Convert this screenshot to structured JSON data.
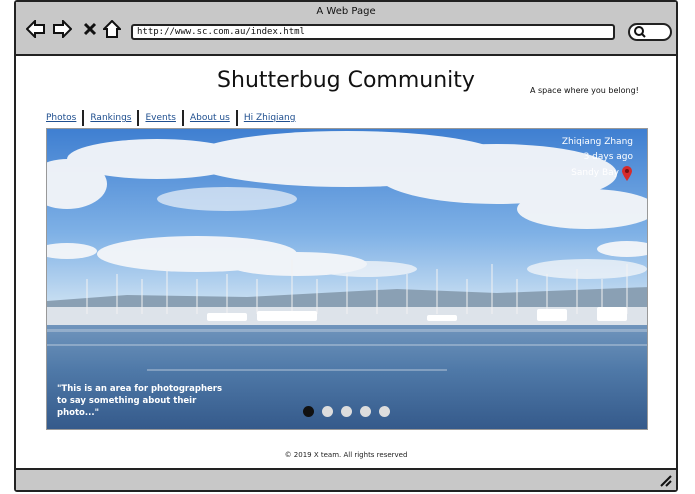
{
  "window": {
    "title": "A Web Page"
  },
  "browser": {
    "url": "http://www.sc.com.au/index.html"
  },
  "site": {
    "title": "Shutterbug Community",
    "tagline": "A space where you belong!"
  },
  "nav": {
    "items": [
      {
        "label": "Photos"
      },
      {
        "label": "Rankings"
      },
      {
        "label": "Events"
      },
      {
        "label": "About us"
      },
      {
        "label": "Hi Zhiqiang"
      }
    ]
  },
  "photo": {
    "author": "Zhiqiang Zhang",
    "age": "3 days ago",
    "location": "Sandy Bay",
    "caption": "\"This is an area for photographers to say something about their photo...\"",
    "slides": 5,
    "active_slide": 1
  },
  "footer": {
    "text": "© 2019 X team. All rights reserved"
  },
  "colors": {
    "link": "#1f4f8f",
    "pin": "#d62b2b",
    "chrome": "#c8c8c8"
  }
}
